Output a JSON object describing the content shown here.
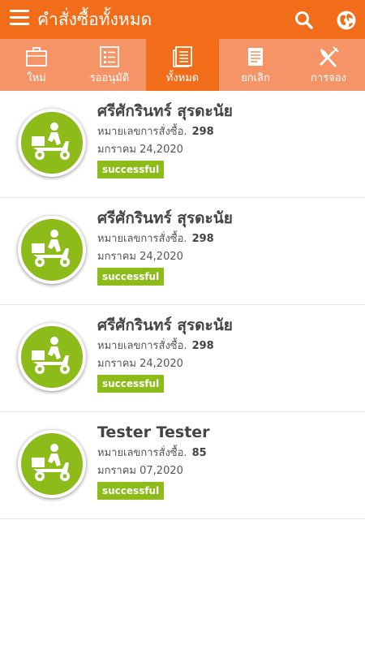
{
  "appbar": {
    "title": "คำสั่งซื้อทั้งหมด",
    "actions": {
      "search_icon": "search-icon",
      "globe_icon": "globe-icon"
    }
  },
  "colors": {
    "primary": "#f26d1a",
    "tab_bar": "#f59467",
    "status_success": "#8dbb1a",
    "text_dark": "#444444"
  },
  "tabs": [
    {
      "label": "ใหม่",
      "icon": "briefcase-icon",
      "active": false
    },
    {
      "label": "รออนุมัติ",
      "icon": "checklist-icon",
      "active": false
    },
    {
      "label": "ทั้งหมด",
      "icon": "document-list-icon",
      "active": true
    },
    {
      "label": "ยกเลิก",
      "icon": "note-icon",
      "active": false
    },
    {
      "label": "การจอง",
      "icon": "utensils-icon",
      "active": false
    }
  ],
  "orders": [
    {
      "name": "ศรีศักรินทร์ สุรดะนัย",
      "order_label": "หมายเลขการสั่งซื้อ.",
      "order_number": "298",
      "date": "มกราคม 24,2020",
      "status": "successful",
      "avatar_icon": "delivery-scooter-icon"
    },
    {
      "name": "ศรีศักรินทร์ สุรดะนัย",
      "order_label": "หมายเลขการสั่งซื้อ.",
      "order_number": "298",
      "date": "มกราคม 24,2020",
      "status": "successful",
      "avatar_icon": "delivery-scooter-icon"
    },
    {
      "name": "ศรีศักรินทร์ สุรดะนัย",
      "order_label": "หมายเลขการสั่งซื้อ.",
      "order_number": "298",
      "date": "มกราคม 24,2020",
      "status": "successful",
      "avatar_icon": "delivery-scooter-icon"
    },
    {
      "name": "Tester Tester",
      "order_label": "หมายเลขการสั่งซื้อ.",
      "order_number": "85",
      "date": "มกราคม 07,2020",
      "status": "successful",
      "avatar_icon": "delivery-scooter-icon"
    }
  ]
}
